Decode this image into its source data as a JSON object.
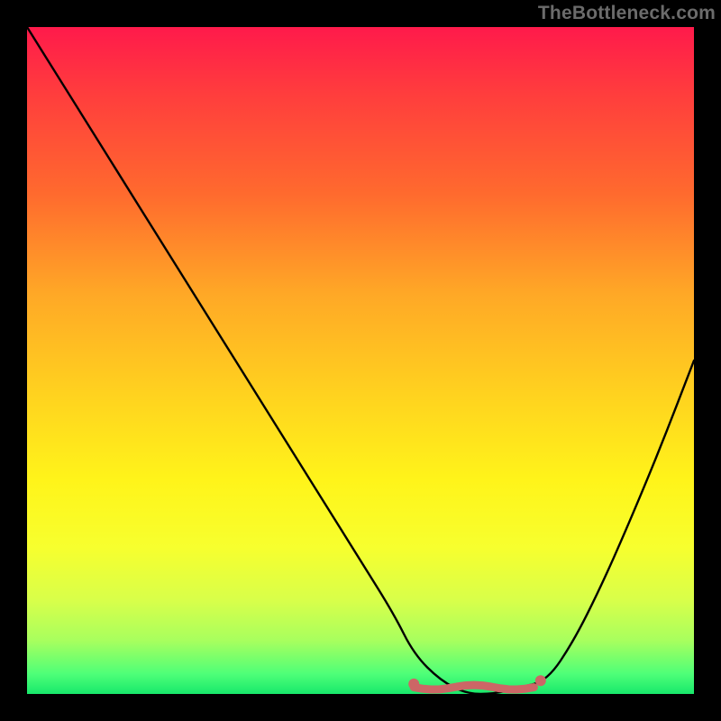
{
  "watermark": "TheBottleneck.com",
  "colors": {
    "background": "#000000",
    "gradient_top": "#ff1a4b",
    "gradient_bottom": "#18e86b",
    "curve": "#000000",
    "marker_fill": "#cc6666",
    "marker_stroke": "#cc6666"
  },
  "chart_data": {
    "type": "line",
    "title": "",
    "xlabel": "",
    "ylabel": "",
    "xlim": [
      0,
      100
    ],
    "ylim": [
      0,
      100
    ],
    "grid": false,
    "legend": false,
    "series": [
      {
        "name": "bottleneck-curve",
        "x": [
          0,
          5,
          10,
          15,
          20,
          25,
          30,
          35,
          40,
          45,
          50,
          55,
          58,
          62,
          66,
          70,
          74,
          78,
          82,
          86,
          90,
          95,
          100
        ],
        "y": [
          100,
          92,
          84,
          76,
          68,
          60,
          52,
          44,
          36,
          28,
          20,
          12,
          6,
          2,
          0,
          0,
          1,
          2,
          8,
          16,
          25,
          37,
          50
        ]
      }
    ],
    "markers": [
      {
        "name": "flat-region-left-dot",
        "x": 58,
        "y": 1.5
      },
      {
        "name": "flat-region-right-dot",
        "x": 77,
        "y": 2.0
      }
    ],
    "flat_region": {
      "x_start": 58,
      "x_end": 76,
      "y": 1.0
    }
  }
}
